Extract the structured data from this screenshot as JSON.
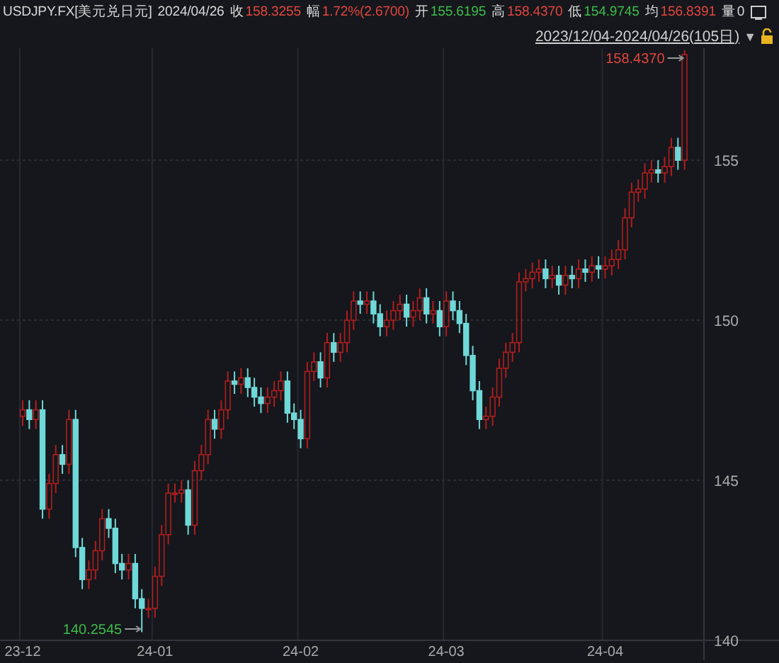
{
  "quote": {
    "symbol": "USDJPY.FX[美元兑日元]",
    "date": "2024/04/26",
    "fields": [
      {
        "label": "收",
        "value": "158.3255",
        "color": "#e0463e"
      },
      {
        "label": "幅",
        "value": "1.72%(2.6700)",
        "color": "#e0463e"
      },
      {
        "label": "开",
        "value": "155.6195",
        "color": "#3dbb4a"
      },
      {
        "label": "高",
        "value": "158.4370",
        "color": "#e0463e"
      },
      {
        "label": "低",
        "value": "154.9745",
        "color": "#3dbb4a"
      },
      {
        "label": "均",
        "value": "156.8391",
        "color": "#e0463e"
      },
      {
        "label": "量",
        "value": "0",
        "color": "#d8d8d8"
      }
    ]
  },
  "range": {
    "label": "2023/12/04-2024/04/26(105日)",
    "caret": "▼"
  },
  "chart_data": {
    "type": "candlestick",
    "categories": [
      "23-12",
      null,
      null,
      null,
      null,
      null,
      null,
      null,
      null,
      null,
      null,
      null,
      null,
      null,
      null,
      null,
      null,
      null,
      null,
      null,
      "24-01",
      null,
      null,
      null,
      null,
      null,
      null,
      null,
      null,
      null,
      null,
      null,
      null,
      null,
      null,
      null,
      null,
      null,
      null,
      null,
      null,
      null,
      "24-02",
      null,
      null,
      null,
      null,
      null,
      null,
      null,
      null,
      null,
      null,
      null,
      null,
      null,
      null,
      null,
      null,
      null,
      null,
      null,
      null,
      null,
      "24-03",
      null,
      null,
      null,
      null,
      null,
      null,
      null,
      null,
      null,
      null,
      null,
      null,
      null,
      null,
      null,
      null,
      null,
      null,
      null,
      null,
      null,
      null,
      null,
      "24-04",
      null,
      null,
      null,
      null,
      null,
      null,
      null,
      null,
      null,
      null,
      null,
      null
    ],
    "yticks": [
      140,
      145,
      150,
      155
    ],
    "ylim": [
      140,
      158.5
    ],
    "grid": true,
    "ohlc": [
      [
        147.0,
        147.5,
        146.7,
        147.2
      ],
      [
        147.2,
        147.5,
        146.6,
        146.9
      ],
      [
        146.9,
        147.5,
        146.6,
        147.2
      ],
      [
        147.2,
        147.5,
        143.8,
        144.1
      ],
      [
        144.1,
        145.2,
        143.8,
        144.9
      ],
      [
        144.9,
        146.1,
        144.6,
        145.8
      ],
      [
        145.8,
        146.1,
        145.2,
        145.5
      ],
      [
        145.5,
        147.2,
        145.2,
        146.9
      ],
      [
        146.9,
        147.2,
        142.6,
        142.9
      ],
      [
        142.9,
        143.2,
        141.6,
        141.9
      ],
      [
        141.9,
        142.5,
        141.6,
        142.2
      ],
      [
        142.2,
        143.1,
        141.9,
        142.8
      ],
      [
        142.8,
        144.1,
        142.5,
        143.8
      ],
      [
        143.8,
        144.1,
        143.2,
        143.5
      ],
      [
        143.5,
        143.8,
        142.1,
        142.4
      ],
      [
        142.4,
        142.7,
        141.9,
        142.2
      ],
      [
        142.2,
        142.7,
        141.9,
        142.4
      ],
      [
        142.4,
        142.7,
        141.0,
        141.3
      ],
      [
        141.3,
        141.6,
        140.2545,
        141.0
      ],
      [
        141.0,
        141.3,
        140.7,
        141.0
      ],
      [
        141.0,
        142.3,
        140.7,
        142.0
      ],
      [
        142.0,
        143.6,
        141.7,
        143.3
      ],
      [
        143.3,
        144.9,
        143.0,
        144.6
      ],
      [
        144.6,
        144.9,
        144.3,
        144.6
      ],
      [
        144.6,
        145.0,
        144.3,
        144.7
      ],
      [
        144.7,
        145.0,
        143.3,
        143.6
      ],
      [
        143.6,
        145.6,
        143.3,
        145.3
      ],
      [
        145.3,
        146.1,
        145.0,
        145.8
      ],
      [
        145.8,
        147.2,
        145.5,
        146.9
      ],
      [
        146.9,
        147.2,
        146.3,
        146.6
      ],
      [
        146.6,
        147.5,
        146.3,
        147.2
      ],
      [
        147.2,
        148.4,
        146.9,
        148.1
      ],
      [
        148.1,
        148.4,
        147.7,
        148.0
      ],
      [
        148.0,
        148.5,
        147.7,
        148.2
      ],
      [
        148.2,
        148.5,
        147.6,
        147.9
      ],
      [
        147.9,
        148.2,
        147.3,
        147.6
      ],
      [
        147.6,
        147.9,
        147.1,
        147.4
      ],
      [
        147.4,
        147.9,
        147.1,
        147.6
      ],
      [
        147.6,
        148.1,
        147.3,
        147.8
      ],
      [
        147.8,
        148.4,
        147.5,
        148.1
      ],
      [
        148.1,
        148.4,
        146.8,
        147.1
      ],
      [
        147.1,
        147.4,
        146.6,
        146.9
      ],
      [
        146.9,
        147.2,
        146.0,
        146.3
      ],
      [
        146.3,
        148.7,
        146.0,
        148.4
      ],
      [
        148.4,
        149.0,
        148.1,
        148.7
      ],
      [
        148.7,
        149.0,
        147.9,
        148.2
      ],
      [
        148.2,
        149.6,
        147.9,
        149.3
      ],
      [
        149.3,
        149.6,
        148.7,
        149.0
      ],
      [
        149.0,
        149.6,
        148.7,
        149.3
      ],
      [
        149.3,
        150.3,
        149.0,
        150.0
      ],
      [
        150.0,
        150.9,
        149.7,
        150.6
      ],
      [
        150.6,
        150.9,
        150.2,
        150.5
      ],
      [
        150.5,
        150.9,
        150.2,
        150.6
      ],
      [
        150.6,
        150.9,
        149.9,
        150.2
      ],
      [
        150.2,
        150.5,
        149.5,
        149.8
      ],
      [
        149.8,
        150.3,
        149.5,
        150.0
      ],
      [
        150.0,
        150.6,
        149.7,
        150.3
      ],
      [
        150.3,
        150.8,
        150.0,
        150.5
      ],
      [
        150.5,
        150.8,
        149.8,
        150.1
      ],
      [
        150.1,
        150.6,
        149.8,
        150.3
      ],
      [
        150.3,
        151.0,
        150.0,
        150.7
      ],
      [
        150.7,
        151.0,
        149.9,
        150.2
      ],
      [
        150.2,
        150.6,
        149.9,
        150.3
      ],
      [
        150.3,
        150.6,
        149.5,
        149.8
      ],
      [
        149.8,
        150.9,
        149.5,
        150.6
      ],
      [
        150.6,
        150.9,
        150.0,
        150.3
      ],
      [
        150.3,
        150.6,
        149.6,
        149.9
      ],
      [
        149.9,
        150.2,
        148.6,
        148.9
      ],
      [
        148.9,
        149.2,
        147.5,
        147.8
      ],
      [
        147.8,
        148.1,
        146.6,
        146.9
      ],
      [
        146.9,
        147.3,
        146.6,
        147.0
      ],
      [
        147.0,
        147.9,
        146.7,
        147.6
      ],
      [
        147.6,
        148.8,
        147.3,
        148.5
      ],
      [
        148.5,
        149.3,
        148.2,
        149.0
      ],
      [
        149.0,
        149.6,
        148.7,
        149.3
      ],
      [
        149.3,
        151.5,
        149.0,
        151.2
      ],
      [
        151.2,
        151.6,
        150.9,
        151.3
      ],
      [
        151.3,
        151.8,
        151.0,
        151.5
      ],
      [
        151.5,
        151.9,
        151.2,
        151.6
      ],
      [
        151.6,
        151.9,
        151.0,
        151.3
      ],
      [
        151.3,
        151.7,
        151.0,
        151.4
      ],
      [
        151.4,
        151.7,
        150.8,
        151.1
      ],
      [
        151.1,
        151.7,
        150.8,
        151.4
      ],
      [
        151.4,
        151.7,
        151.0,
        151.3
      ],
      [
        151.3,
        151.9,
        151.0,
        151.6
      ],
      [
        151.6,
        151.9,
        151.2,
        151.5
      ],
      [
        151.5,
        152.0,
        151.2,
        151.7
      ],
      [
        151.7,
        152.0,
        151.3,
        151.6
      ],
      [
        151.6,
        152.0,
        151.3,
        151.7
      ],
      [
        151.7,
        152.2,
        151.4,
        151.9
      ],
      [
        151.9,
        152.5,
        151.6,
        152.2
      ],
      [
        152.2,
        153.5,
        151.9,
        153.2
      ],
      [
        153.2,
        154.3,
        152.9,
        154.0
      ],
      [
        154.0,
        154.4,
        153.7,
        154.1
      ],
      [
        154.1,
        154.9,
        153.8,
        154.6
      ],
      [
        154.6,
        155.0,
        154.3,
        154.7
      ],
      [
        154.7,
        155.0,
        154.3,
        154.6
      ],
      [
        154.6,
        155.1,
        154.3,
        154.8
      ],
      [
        154.8,
        155.7,
        154.5,
        155.4
      ],
      [
        155.4,
        155.7,
        154.7,
        155.0
      ],
      [
        155.0,
        158.437,
        154.7,
        158.3
      ]
    ],
    "annotations": [
      "158.4370",
      "140.2545"
    ]
  }
}
